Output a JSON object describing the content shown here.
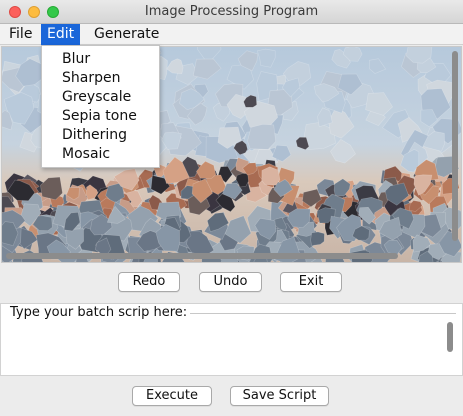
{
  "window": {
    "title": "Image Processing Program"
  },
  "menubar": {
    "items": [
      {
        "label": "File"
      },
      {
        "label": "Edit"
      },
      {
        "label": "Generate"
      }
    ]
  },
  "edit_menu": {
    "items": [
      "Blur",
      "Sharpen",
      "Greyscale",
      "Sepia tone",
      "Dithering",
      "Mosaic"
    ]
  },
  "image_panel": {
    "description": "mosaic-filtered landscape photo",
    "vertical_scroll_fraction": 0.0,
    "horizontal_scroll_fraction": 0.0
  },
  "history_buttons": {
    "redo": "Redo",
    "undo": "Undo",
    "exit": "Exit"
  },
  "script": {
    "legend": "Type your batch scrip here:",
    "value": ""
  },
  "script_buttons": {
    "execute": "Execute",
    "save": "Save Script"
  },
  "colors": {
    "menu_highlight": "#1a66d9",
    "close": "#fc605c",
    "minimize": "#fdbc40",
    "maximize": "#34c84a"
  }
}
